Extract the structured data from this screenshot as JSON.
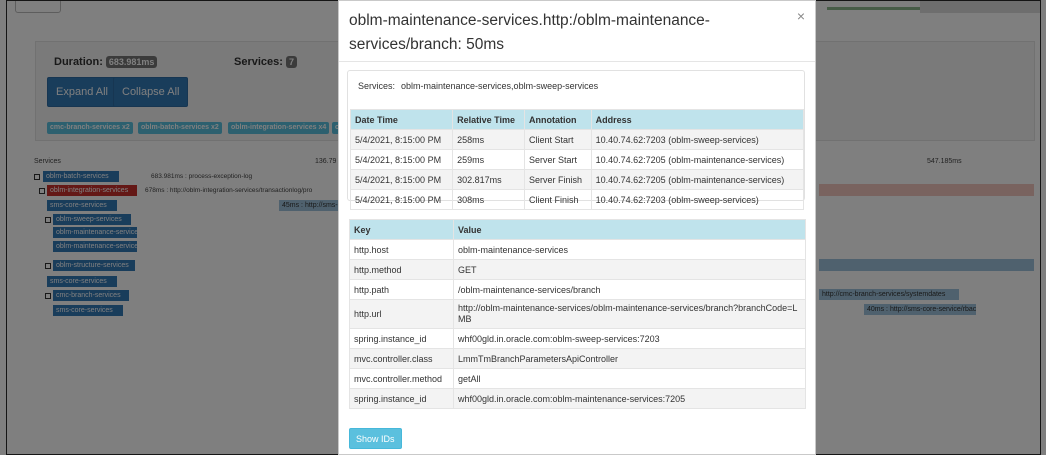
{
  "background": {
    "duration_label": "Duration:",
    "duration_value": "683.981ms",
    "services_label": "Services:",
    "services_value": "7",
    "expand_all": "Expand All",
    "collapse_all": "Collapse All",
    "service_tags": [
      "cmc-branch-services x2",
      "oblm-batch-services x2",
      "oblm-integration-services x4",
      "ob"
    ],
    "trace_header": {
      "services": "Services",
      "tick_mid": "136.79",
      "tick_right": "547.185ms"
    },
    "tree": [
      {
        "name": "oblm-batch-services",
        "span": "683.981ms : process-exception-log"
      },
      {
        "name": "oblm-integration-services",
        "span": "678ms : http://oblm-integration-services/transactionlog/pro"
      },
      {
        "name": "sms-core-services",
        "span": "45ms : http://sms-c"
      },
      {
        "name": "oblm-sweep-services",
        "span": ""
      },
      {
        "name": "oblm-maintenance-services",
        "span": ""
      },
      {
        "name": "oblm-maintenance-services",
        "span": ""
      },
      {
        "name": "oblm-structure-services",
        "span": ""
      },
      {
        "name": "sms-core-services",
        "span": ""
      },
      {
        "name": "cmc-branch-services",
        "span": ""
      },
      {
        "name": "sms-core-services",
        "span": ""
      }
    ],
    "right_span_1": "http://cmc-branch-services/systemdates",
    "right_span_2": "40ms : http://sms-core-service/rbac"
  },
  "modal": {
    "title": "oblm-maintenance-services.http:/oblm-maintenance-services/branch: 50ms",
    "close": "×",
    "services_label": "Services:",
    "services_value": "oblm-maintenance-services,oblm-sweep-services",
    "annotation_headers": [
      "Date Time",
      "Relative Time",
      "Annotation",
      "Address"
    ],
    "annotations": [
      [
        "5/4/2021, 8:15:00 PM",
        "258ms",
        "Client Start",
        "10.40.74.62:7203 (oblm-sweep-services)"
      ],
      [
        "5/4/2021, 8:15:00 PM",
        "259ms",
        "Server Start",
        "10.40.74.62:7205 (oblm-maintenance-services)"
      ],
      [
        "5/4/2021, 8:15:00 PM",
        "302.817ms",
        "Server Finish",
        "10.40.74.62:7205 (oblm-maintenance-services)"
      ],
      [
        "5/4/2021, 8:15:00 PM",
        "308ms",
        "Client Finish",
        "10.40.74.62:7203 (oblm-sweep-services)"
      ]
    ],
    "tag_headers": [
      "Key",
      "Value"
    ],
    "tags": [
      [
        "http.host",
        "oblm-maintenance-services"
      ],
      [
        "http.method",
        "GET"
      ],
      [
        "http.path",
        "/oblm-maintenance-services/branch"
      ],
      [
        "http.url",
        "http://oblm-maintenance-services/oblm-maintenance-services/branch?branchCode=LMB"
      ],
      [
        "spring.instance_id",
        "whf00gld.in.oracle.com:oblm-sweep-services:7203"
      ],
      [
        "mvc.controller.class",
        "LmmTmBranchParametersApiController"
      ],
      [
        "mvc.controller.method",
        "getAll"
      ],
      [
        "spring.instance_id",
        "whf00gld.in.oracle.com:oblm-maintenance-services:7205"
      ]
    ],
    "show_ids": "Show IDs"
  },
  "colors": {
    "primary_button": "#337ab7",
    "info_button": "#5bc0de",
    "table_header": "#bfe3ec",
    "service_blue": "#337ab7",
    "service_red": "#c9302c"
  }
}
